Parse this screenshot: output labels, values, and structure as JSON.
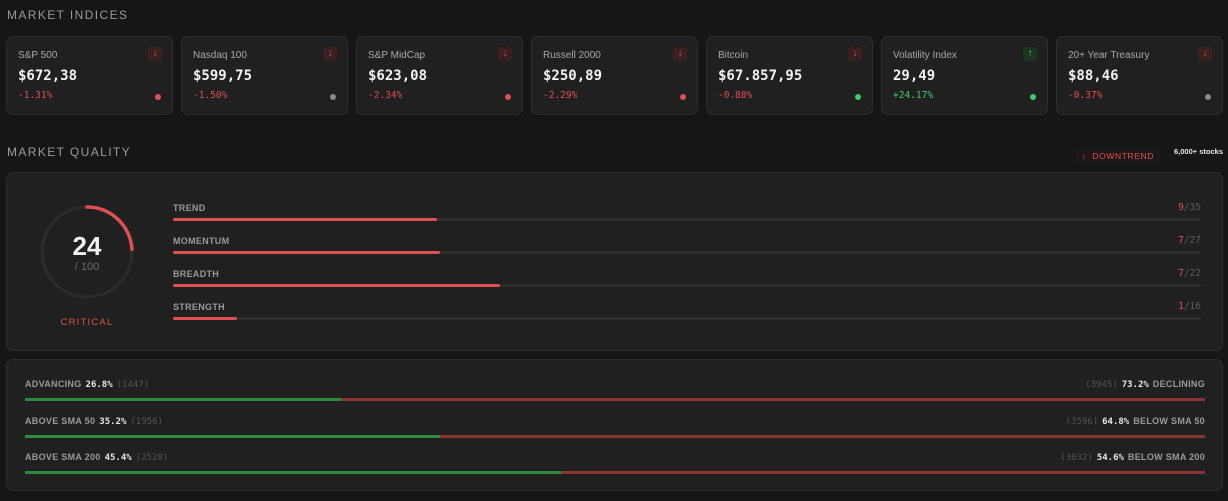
{
  "sections": {
    "indices_title": "MARKET INDICES",
    "quality_title": "MARKET QUALITY"
  },
  "indices": [
    {
      "name": "S&P 500",
      "price": "$672,38",
      "change": "-1.31%",
      "direction": "down",
      "dot_color": "#e05050"
    },
    {
      "name": "Nasdaq 100",
      "price": "$599,75",
      "change": "-1.50%",
      "direction": "down",
      "dot_color": "#8a8a8a"
    },
    {
      "name": "S&P MidCap",
      "price": "$623,08",
      "change": "-2.34%",
      "direction": "down",
      "dot_color": "#e05050"
    },
    {
      "name": "Russell 2000",
      "price": "$250,89",
      "change": "-2.29%",
      "direction": "down",
      "dot_color": "#e05050"
    },
    {
      "name": "Bitcoin",
      "price": "$67.857,95",
      "change": "-0.88%",
      "direction": "down",
      "dot_color": "#3fcf6a"
    },
    {
      "name": "Volatility Index",
      "price": "29,49",
      "change": "+24.17%",
      "direction": "up",
      "dot_color": "#3fcf6a"
    },
    {
      "name": "20+ Year Treasury",
      "price": "$88,46",
      "change": "-0.37%",
      "direction": "down",
      "dot_color": "#8a8a8a"
    }
  ],
  "quality": {
    "trend_tag": "DOWNTREND",
    "stocks_count": "6,000+ stocks",
    "score": "24",
    "score_max": "/ 100",
    "score_fraction": 0.24,
    "status": "CRITICAL",
    "metrics": [
      {
        "label": "TREND",
        "value": "9",
        "max": "35"
      },
      {
        "label": "MOMENTUM",
        "value": "7",
        "max": "27"
      },
      {
        "label": "BREADTH",
        "value": "7",
        "max": "22"
      },
      {
        "label": "STRENGTH",
        "value": "1",
        "max": "16"
      }
    ]
  },
  "breadth": [
    {
      "left_label": "ADVANCING",
      "left_pct": "26.8%",
      "left_count": "(1447)",
      "right_count": "(3945)",
      "right_pct": "73.2%",
      "right_label": "DECLINING",
      "fraction": 0.268
    },
    {
      "left_label": "ABOVE  SMA 50",
      "left_pct": "35.2%",
      "left_count": "(1956)",
      "right_count": "(3596)",
      "right_pct": "64.8%",
      "right_label": "BELOW  SMA 50",
      "fraction": 0.352
    },
    {
      "left_label": "ABOVE  SMA 200",
      "left_pct": "45.4%",
      "left_count": "(2528)",
      "right_count": "(3032)",
      "right_pct": "54.6%",
      "right_label": "BELOW  SMA 200",
      "fraction": 0.454
    }
  ],
  "colors": {
    "negative": "#e05050",
    "positive": "#3fcf6a",
    "bar_green": "#2d8a3e",
    "bar_red": "#8a3434"
  }
}
